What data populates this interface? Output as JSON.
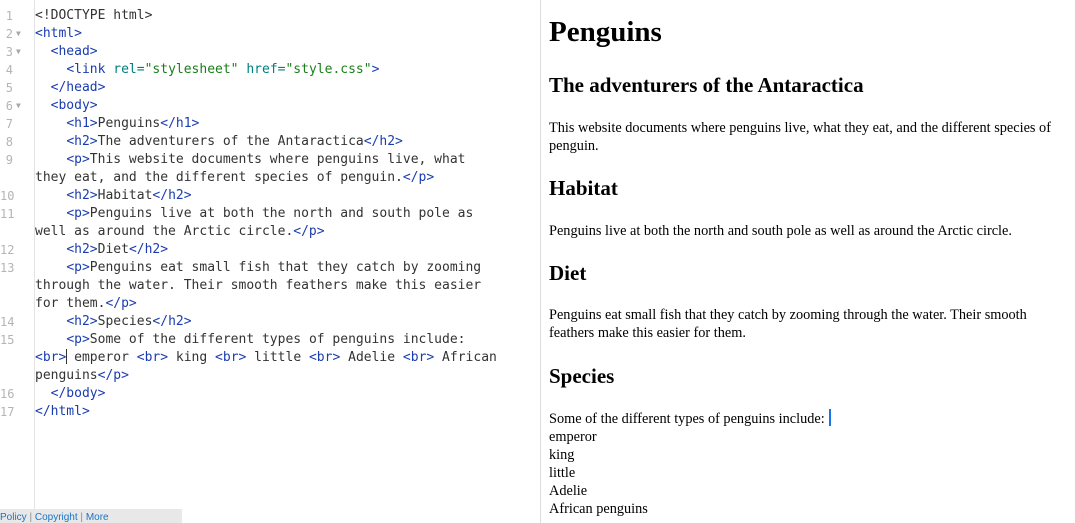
{
  "editor": {
    "line_numbers": [
      "1",
      "2",
      "3",
      "4",
      "5",
      "6",
      "7",
      "8",
      "9",
      "10",
      "11",
      "12",
      "13",
      "14",
      "15",
      "16",
      "17"
    ],
    "lines": {
      "l1": {
        "doctype": "<!DOCTYPE html>"
      },
      "l2": {
        "open": "<html>"
      },
      "l3": {
        "open": "<head>"
      },
      "l4": {
        "tag_open": "<link",
        "attr1": "rel=",
        "val1": "\"stylesheet\"",
        "attr2": "href=",
        "val2": "\"style.css\"",
        "tag_close": ">"
      },
      "l5": {
        "close": "</head>"
      },
      "l6": {
        "open": "<body>"
      },
      "l7": {
        "open": "<h1>",
        "text": "Penguins",
        "close": "</h1>"
      },
      "l8": {
        "open": "<h2>",
        "text": "The adventurers of the Antaractica",
        "close": "</h2>"
      },
      "l9": {
        "open": "<p>",
        "text_a": "This website documents where penguins live, what",
        "text_b": "they eat, and the different species of penguin.",
        "close": "</p>"
      },
      "l10": {
        "open": "<h2>",
        "text": "Habitat",
        "close": "</h2>"
      },
      "l11": {
        "open": "<p>",
        "text_a": "Penguins live at both the north and south pole as",
        "text_b": "well as around the Arctic circle.",
        "close": "</p>"
      },
      "l12": {
        "open": "<h2>",
        "text": "Diet",
        "close": "</h2>"
      },
      "l13": {
        "open": "<p>",
        "text_a": "Penguins eat small fish that they catch by zooming",
        "text_b": "through the water. Their smooth feathers make this easier",
        "text_c": "for them.",
        "close": "</p>"
      },
      "l14": {
        "open": "<h2>",
        "text": "Species",
        "close": "</h2>"
      },
      "l15": {
        "open": "<p>",
        "text_a": "Some of the different types of penguins include:",
        "br": "<br>",
        "w1": " emperor ",
        "w2": " king ",
        "w3": " little ",
        "w4": " Adelie ",
        "w5": " African",
        "text_c": "penguins",
        "close": "</p>"
      },
      "l16": {
        "close": "</body>"
      },
      "l17": {
        "close": "</html>"
      }
    }
  },
  "footer": {
    "policy": "Policy",
    "sep": " | ",
    "copyright": "Copyright",
    "more": "More"
  },
  "preview": {
    "h1": "Penguins",
    "subtitle": "The adventurers of the Antaractica",
    "intro": "This website documents where penguins live, what they eat, and the different species of penguin.",
    "habitat_heading": "Habitat",
    "habitat_text": "Penguins live at both the north and south pole as well as around the Arctic circle.",
    "diet_heading": "Diet",
    "diet_text": "Penguins eat small fish that they catch by zooming through the water. Their smooth feathers make this easier for them.",
    "species_heading": "Species",
    "species_intro": "Some of the different types of penguins include:",
    "species_list": [
      "emperor",
      "king",
      "little",
      "Adelie",
      "African penguins"
    ]
  },
  "colors": {
    "tag": "#1a3cb0",
    "attr": "#008080",
    "string": "#1a7f1a",
    "cursor": "#1a73e8"
  }
}
